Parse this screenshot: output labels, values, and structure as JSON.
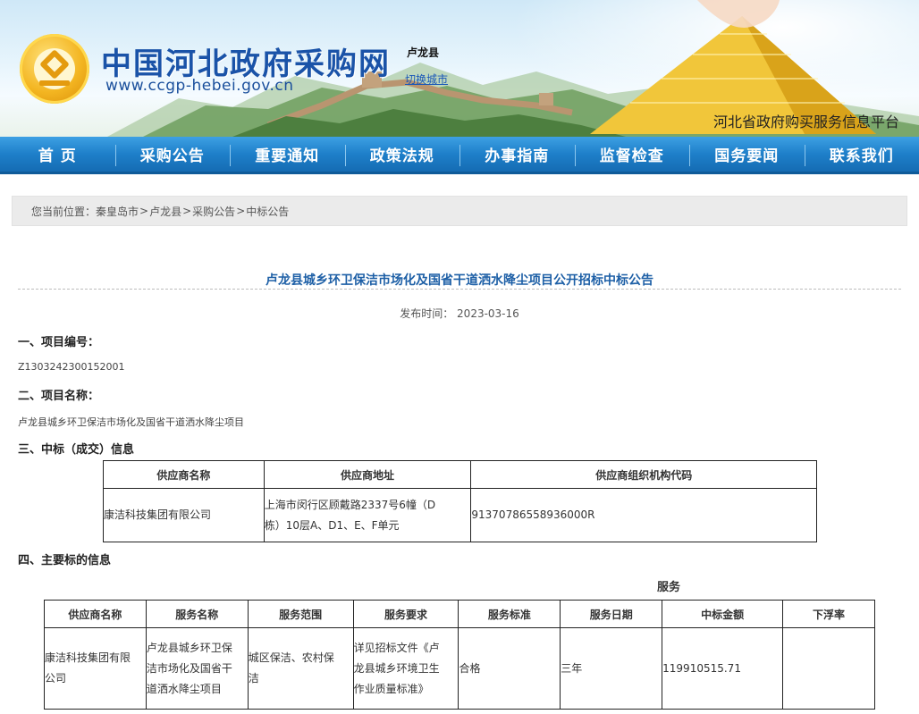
{
  "header": {
    "site_title": "中国河北政府采购网",
    "site_url": "www.ccgp-hebei.gov.cn",
    "region": "卢龙县",
    "switch_city": "切换城市",
    "platform": "河北省政府购买服务信息平台"
  },
  "nav": {
    "items": [
      "首 页",
      "采购公告",
      "重要通知",
      "政策法规",
      "办事指南",
      "监督检查",
      "国务要闻",
      "联系我们"
    ]
  },
  "breadcrumb": {
    "prefix": "您当前位置：",
    "items": [
      "秦皇岛市",
      "卢龙县",
      "采购公告",
      "中标公告"
    ],
    "separator": ">"
  },
  "article": {
    "title": "卢龙县城乡环卫保洁市场化及国省干道洒水降尘项目公开招标中标公告",
    "publish_label": "发布时间：",
    "publish_date": "2023-03-16",
    "sections": {
      "project_no_heading": "一、项目编号：",
      "project_no": "Z1303242300152001",
      "project_name_heading": "二、项目名称：",
      "project_name": "卢龙县城乡环卫保洁市场化及国省干道洒水降尘项目",
      "award_heading": "三、中标（成交）信息",
      "main_info_heading": "四、主要标的信息"
    },
    "award_table": {
      "headers": [
        "供应商名称",
        "供应商地址",
        "供应商组织机构代码"
      ],
      "row": {
        "name": "康洁科技集团有限公司",
        "address_line1": "上海市闵行区顾戴路2337号6幢（D",
        "address_line2": "栋）10层A、D1、E、F单元",
        "code": "91370786558936000R"
      }
    },
    "service_table": {
      "caption": "服务",
      "headers": [
        "供应商名称",
        "服务名称",
        "服务范围",
        "服务要求",
        "服务标准",
        "服务日期",
        "中标金额",
        "下浮率"
      ],
      "row": {
        "supplier_l1": "康洁科技集团有限",
        "supplier_l2": "公司",
        "service_name_l1": "卢龙县城乡环卫保",
        "service_name_l2": "洁市场化及国省干",
        "service_name_l3": "道洒水降尘项目",
        "scope_l1": "城区保洁、农村保",
        "scope_l2": "洁",
        "requirement_l1": "详见招标文件《卢",
        "requirement_l2": "龙县城乡环境卫生",
        "requirement_l3": "作业质量标准》",
        "standard": "合格",
        "date": "三年",
        "amount": "119910515.71",
        "rate": ""
      }
    }
  }
}
